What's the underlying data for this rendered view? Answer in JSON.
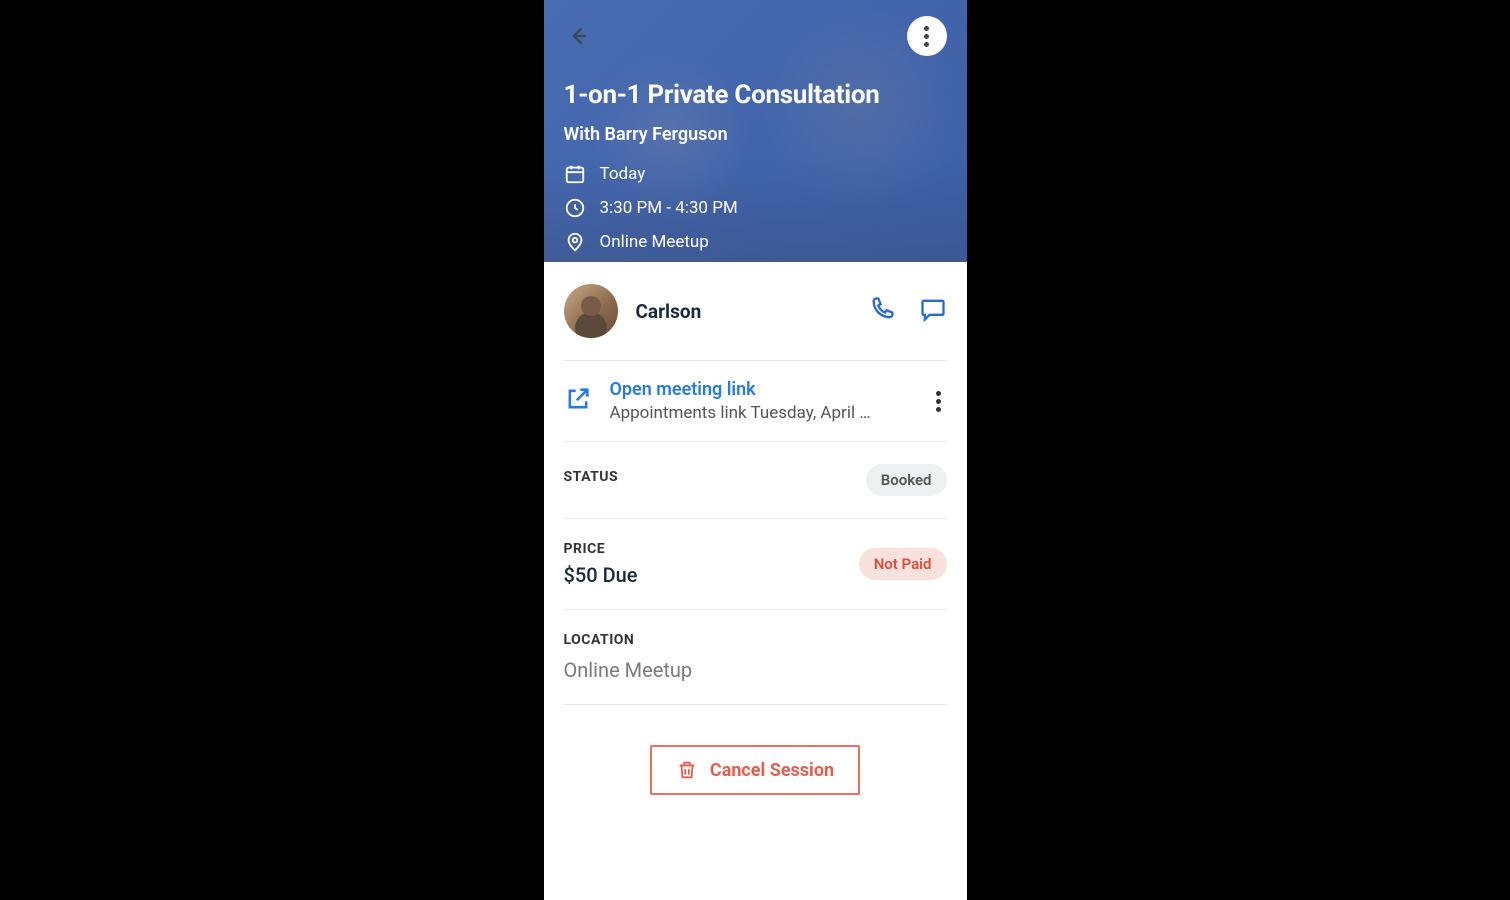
{
  "header": {
    "title": "1-on-1 Private Consultation",
    "subtitle": "With Barry Ferguson",
    "date": "Today",
    "time": "3:30 PM - 4:30 PM",
    "location": "Online Meetup"
  },
  "person": {
    "name": "Carlson"
  },
  "meeting_link": {
    "title": "Open meeting link",
    "subtitle": "Appointments link Tuesday, April …"
  },
  "status": {
    "label": "STATUS",
    "value": "Booked"
  },
  "price": {
    "label": "PRICE",
    "value": "$50 Due",
    "badge": "Not Paid"
  },
  "location": {
    "label": "LOCATION",
    "value": "Online Meetup"
  },
  "cancel_label": "Cancel Session"
}
